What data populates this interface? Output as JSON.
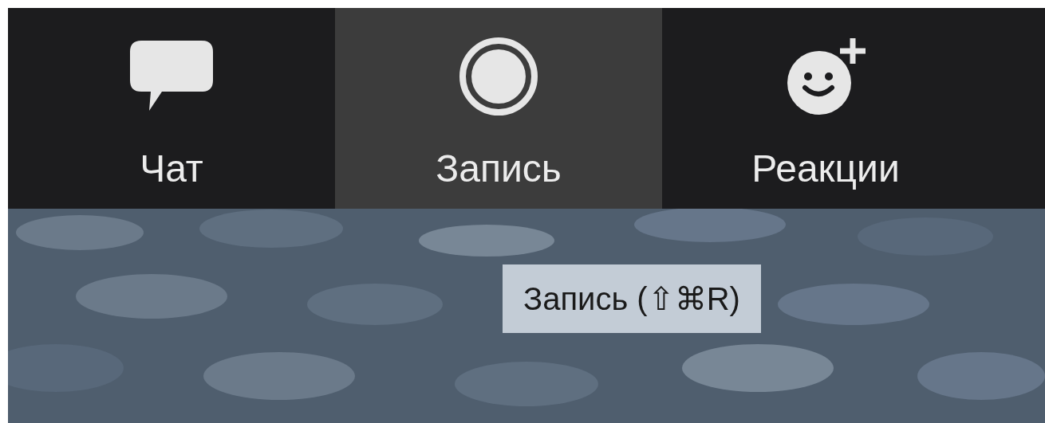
{
  "toolbar": {
    "buttons": [
      {
        "label": "Чат",
        "kind": "chat",
        "selected": false
      },
      {
        "label": "Запись",
        "kind": "record",
        "selected": true
      },
      {
        "label": "Реакции",
        "kind": "reactions",
        "selected": false
      }
    ]
  },
  "tooltip": {
    "text": "Запись (⇧⌘R)"
  }
}
